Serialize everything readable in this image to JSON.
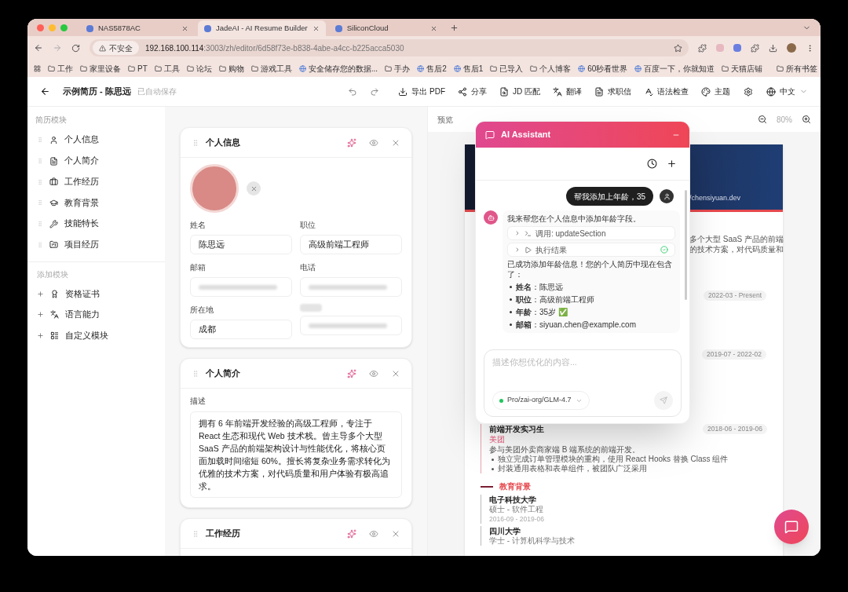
{
  "browser": {
    "tabs": [
      {
        "title": "NAS5878AC",
        "selected": false
      },
      {
        "title": "JadeAI - AI Resume Builder",
        "selected": true
      },
      {
        "title": "SiliconCloud",
        "selected": false
      }
    ],
    "security_badge": "不安全",
    "url_host": "192.168.100.114",
    "url_path": ":3003/zh/editor/6d58f73e-b838-4abe-a4cc-b225acca5030",
    "bookmarks": [
      {
        "label": "工作",
        "kind": "folder"
      },
      {
        "label": "家里设备",
        "kind": "folder"
      },
      {
        "label": "PT",
        "kind": "folder"
      },
      {
        "label": "工具",
        "kind": "folder"
      },
      {
        "label": "论坛",
        "kind": "folder"
      },
      {
        "label": "购物",
        "kind": "folder"
      },
      {
        "label": "游戏工具",
        "kind": "folder"
      },
      {
        "label": "安全储存您的数据...",
        "kind": "site"
      },
      {
        "label": "手办",
        "kind": "folder"
      },
      {
        "label": "售后2",
        "kind": "site"
      },
      {
        "label": "售后1",
        "kind": "site"
      },
      {
        "label": "已导入",
        "kind": "folder"
      },
      {
        "label": "个人博客",
        "kind": "folder"
      },
      {
        "label": "60秒看世界",
        "kind": "site"
      },
      {
        "label": "百度一下，你就知道",
        "kind": "site"
      },
      {
        "label": "天猫店铺",
        "kind": "folder"
      }
    ],
    "all_bookmarks": "所有书签"
  },
  "app_header": {
    "title": "示例简历 - 陈思远",
    "save_status": "已自动保存",
    "actions": [
      "导出 PDF",
      "分享",
      "JD 匹配",
      "翻译",
      "求职信",
      "语法检查",
      "主题"
    ],
    "language": "中文"
  },
  "sidebar": {
    "modules_heading": "简历模块",
    "modules": [
      "个人信息",
      "个人简介",
      "工作经历",
      "教育背景",
      "技能特长",
      "项目经历"
    ],
    "add_heading": "添加模块",
    "add_items": [
      "资格证书",
      "语言能力",
      "自定义模块"
    ]
  },
  "editor": {
    "cards": [
      {
        "kind": "personal",
        "title": "个人信息",
        "fields": [
          {
            "label": "姓名",
            "value": "陈思远"
          },
          {
            "label": "职位",
            "value": "高级前端工程师"
          },
          {
            "label": "邮箱",
            "redacted": true
          },
          {
            "label": "电话",
            "redacted": true
          },
          {
            "label": "所在地",
            "value": "成都"
          },
          {
            "label_redacted": true,
            "redacted": true
          }
        ]
      },
      {
        "kind": "summary",
        "title": "个人简介",
        "field_label": "描述",
        "text": "拥有 6 年前端开发经验的高级工程师，专注于 React 生态和现代 Web 技术栈。曾主导多个大型 SaaS 产品的前端架构设计与性能优化，将核心页面加载时间缩短 60%。擅长将复杂业务需求转化为优雅的技术方案，对代码质量和用户体验有极高追求。"
      },
      {
        "kind": "work",
        "title": "工作经历"
      }
    ]
  },
  "preview": {
    "title": "预览",
    "zoom": "80%",
    "website": "/chensiyuan.dev",
    "summary_lines": [
      "多个大型 SaaS 产品的前端",
      "的技术方案，对代码质量和"
    ],
    "date_chips": [
      "2022-03 - Present",
      "2019-07 - 2022-02"
    ],
    "internship": {
      "role": "前端开发实习生",
      "company": "美团",
      "description": "参与美团外卖商家端 B 端系统的前端开发。",
      "bullets": [
        "独立完成订单管理模块的重构，使用 React Hooks 替换 Class 组件",
        "封装通用表格和表单组件，被团队广泛采用"
      ],
      "dates": "2018-06 - 2019-06"
    },
    "education_heading": "教育背景",
    "education": [
      {
        "school": "电子科技大学",
        "degree": "硕士 - 软件工程",
        "dates": "2016-09 - 2019-06"
      },
      {
        "school": "四川大学",
        "degree": "学士 - 计算机科学与技术"
      }
    ]
  },
  "assistant": {
    "title": "AI Assistant",
    "user_message": "帮我添加上年龄，35",
    "reply_intro": "我来帮您在个人信息中添加年龄字段。",
    "tools": [
      {
        "label": "调用: updateSection",
        "kind": "call",
        "succeeded": false
      },
      {
        "label": "执行结果",
        "kind": "result",
        "succeeded": true
      }
    ],
    "reply_summary": "已成功添加年龄信息！您的个人简历中现在包含了：",
    "reply_items": [
      "**姓名**：陈思远",
      "**职位**：高级前端工程师",
      "**年龄**：35岁 ✅",
      "**邮箱**：siyuan.chen@example.com"
    ],
    "input_placeholder": "描述你想优化的内容...",
    "model": "Pro/zai-org/GLM-4.7"
  }
}
